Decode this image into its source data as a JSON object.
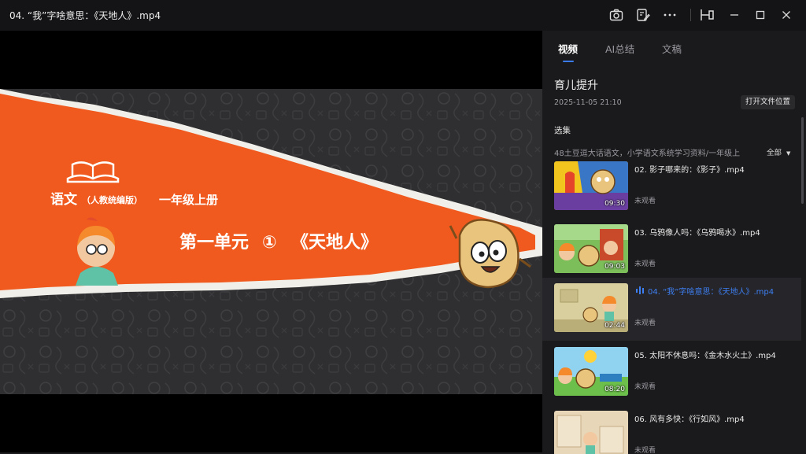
{
  "window": {
    "title": "04. “我”字啥意思：《天地人》.mp4"
  },
  "video": {
    "line1_main": "语文",
    "line1_edition": "（人教统编版）",
    "line1_grade": "一年级上册",
    "line2": "第一单元",
    "line2_num": "①",
    "line2_lesson": "《天地人》"
  },
  "sidebar": {
    "tabs": [
      {
        "label": "视频"
      },
      {
        "label": "AI总结"
      },
      {
        "label": "文稿"
      }
    ],
    "info_title": "育儿提升",
    "info_time": "2025-11-05 21:10",
    "open_folder": "打开文件位置",
    "section_label": "选集",
    "playlist_name": "48土豆逗大话语文，小学语文系统学习资料/一年级上",
    "filter_label": "全部"
  },
  "episodes": [
    {
      "title": "02. 影子哪来的：《影子》.mp4",
      "duration": "09:30",
      "status": "未观看"
    },
    {
      "title": "03. 乌鸦像人吗：《乌鸦喝水》.mp4",
      "duration": "09:03",
      "status": "未观看"
    },
    {
      "title": "04. “我”字啥意思：《天地人》.mp4",
      "duration": "02:44",
      "status": "未观看"
    },
    {
      "title": "05. 太阳不休息吗：《金木水火土》.mp4",
      "duration": "08:20",
      "status": "未观看"
    },
    {
      "title": "06. 风有多快：《行如风》.mp4",
      "duration": "",
      "status": "未观看"
    }
  ],
  "colors": {
    "accent": "#3a7bf0",
    "video_orange": "#f05a1e",
    "sidebar_bg": "#1a1a1c"
  }
}
